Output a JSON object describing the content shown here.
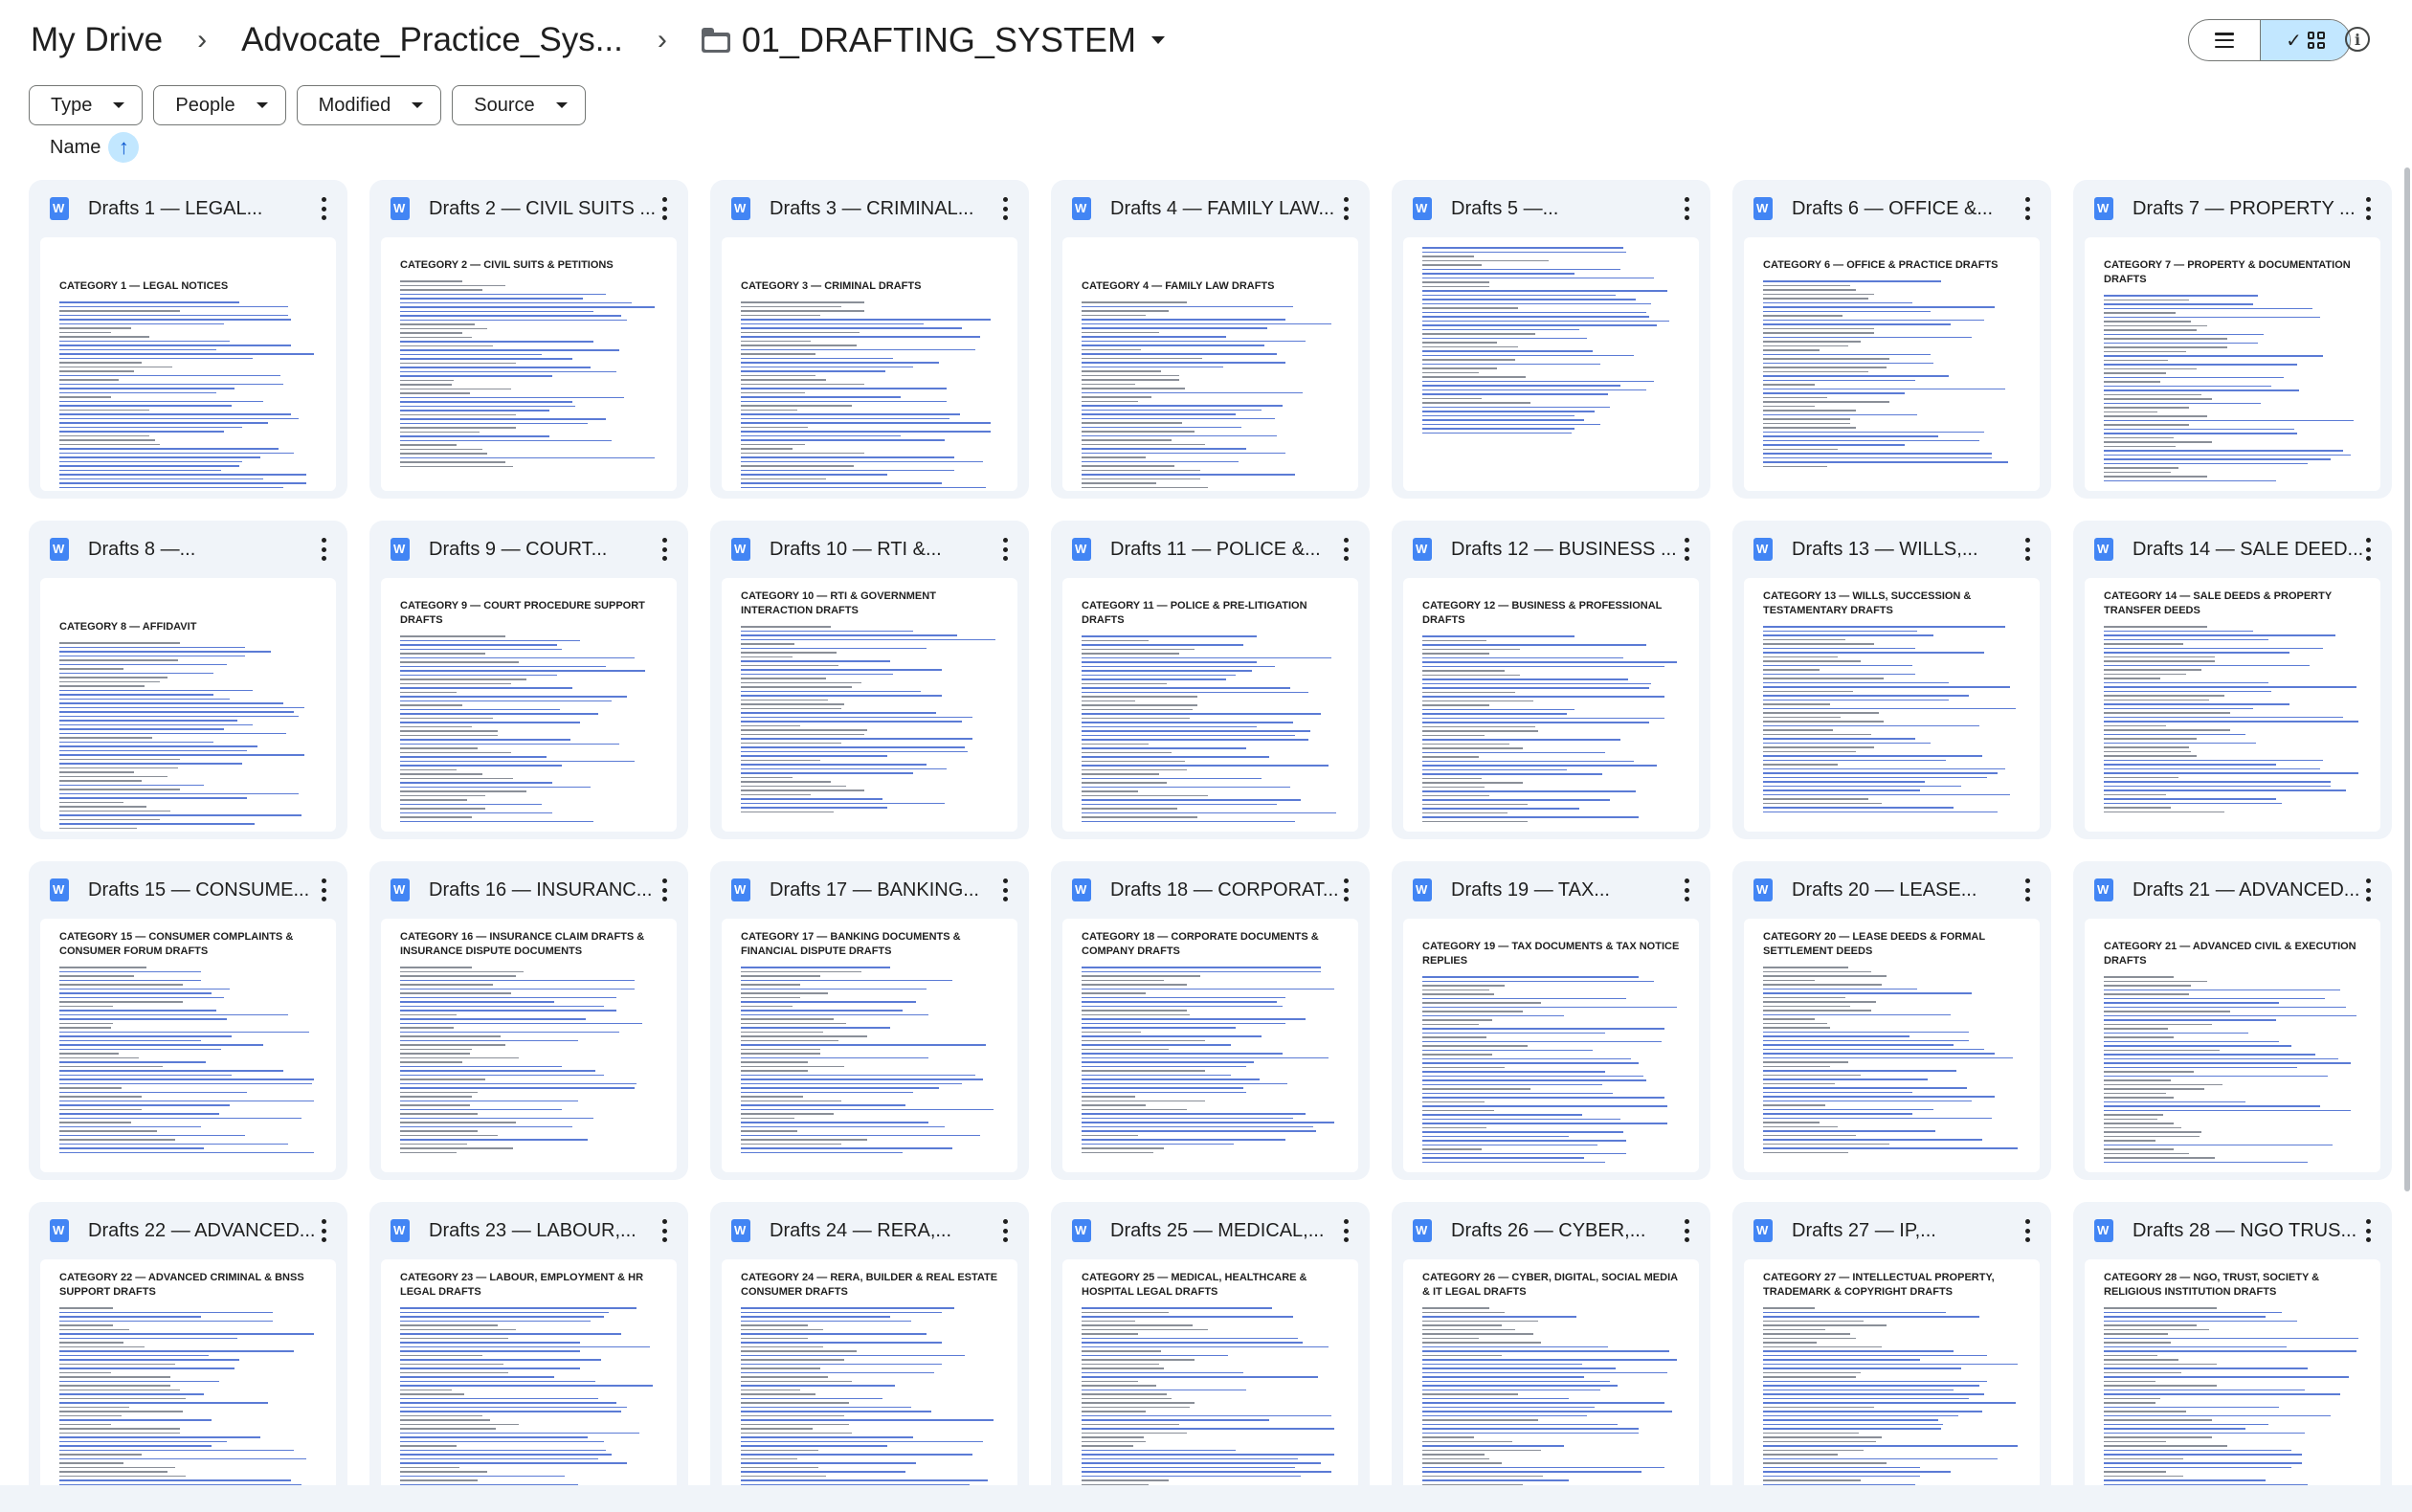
{
  "breadcrumb": {
    "root": "My Drive",
    "parent": "Advocate_Practice_Sys...",
    "current": "01_DRAFTING_SYSTEM",
    "separator": "›"
  },
  "view": {
    "list_icon": "list-view-icon",
    "grid_icon": "grid-view-icon",
    "active": "grid",
    "info_icon": "info-icon"
  },
  "filters": [
    {
      "label": "Type"
    },
    {
      "label": "People"
    },
    {
      "label": "Modified"
    },
    {
      "label": "Source"
    }
  ],
  "sort": {
    "label": "Name",
    "direction_icon": "arrow-up-icon",
    "arrow": "↑"
  },
  "colors": {
    "accent": "#c2e7ff",
    "card_bg": "#f0f4f9",
    "doc_icon": "#4285f4"
  },
  "files": [
    {
      "title": "Drafts 1 — LEGAL...",
      "heading": "CATEGORY 1 — LEGAL NOTICES"
    },
    {
      "title": "Drafts 2 — CIVIL SUITS ...",
      "heading": "CATEGORY 2 — CIVIL SUITS & PETITIONS"
    },
    {
      "title": "Drafts 3 — CRIMINAL...",
      "heading": "CATEGORY 3 — CRIMINAL DRAFTS"
    },
    {
      "title": "Drafts 4 — FAMILY LAW...",
      "heading": "CATEGORY 4 — FAMILY LAW DRAFTS"
    },
    {
      "title": "Drafts 5 —...",
      "heading": ""
    },
    {
      "title": "Drafts 6 — OFFICE &...",
      "heading": "CATEGORY 6 — OFFICE & PRACTICE DRAFTS"
    },
    {
      "title": "Drafts 7 — PROPERTY ...",
      "heading": "CATEGORY 7 — PROPERTY & DOCUMENTATION DRAFTS"
    },
    {
      "title": "Drafts 8 —...",
      "heading": "CATEGORY 8 — AFFIDAVIT"
    },
    {
      "title": "Drafts 9 — COURT...",
      "heading": "CATEGORY 9 — COURT PROCEDURE SUPPORT DRAFTS"
    },
    {
      "title": "Drafts 10 — RTI &...",
      "heading": "CATEGORY 10 — RTI & GOVERNMENT INTERACTION DRAFTS"
    },
    {
      "title": "Drafts 11 — POLICE &...",
      "heading": "CATEGORY 11 — POLICE & PRE-LITIGATION DRAFTS"
    },
    {
      "title": "Drafts 12 — BUSINESS ...",
      "heading": "CATEGORY 12 — BUSINESS & PROFESSIONAL DRAFTS"
    },
    {
      "title": "Drafts 13 — WILLS,...",
      "heading": "CATEGORY 13 — WILLS, SUCCESSION & TESTAMENTARY DRAFTS"
    },
    {
      "title": "Drafts 14 — SALE DEED...",
      "heading": "CATEGORY 14 — SALE DEEDS & PROPERTY TRANSFER DEEDS"
    },
    {
      "title": "Drafts 15 — CONSUME...",
      "heading": "CATEGORY 15 — CONSUMER COMPLAINTS & CONSUMER FORUM DRAFTS"
    },
    {
      "title": "Drafts 16 — INSURANC...",
      "heading": "CATEGORY 16 — INSURANCE CLAIM DRAFTS & INSURANCE DISPUTE DOCUMENTS"
    },
    {
      "title": "Drafts 17 — BANKING...",
      "heading": "CATEGORY 17 — BANKING DOCUMENTS & FINANCIAL DISPUTE DRAFTS"
    },
    {
      "title": "Drafts 18 — CORPORAT...",
      "heading": "CATEGORY 18 — CORPORATE DOCUMENTS & COMPANY DRAFTS"
    },
    {
      "title": "Drafts 19 — TAX...",
      "heading": "CATEGORY 19 — TAX DOCUMENTS & TAX NOTICE REPLIES"
    },
    {
      "title": "Drafts 20 — LEASE...",
      "heading": "CATEGORY 20 — LEASE DEEDS & FORMAL SETTLEMENT DEEDS"
    },
    {
      "title": "Drafts 21 — ADVANCED...",
      "heading": "CATEGORY 21 — ADVANCED CIVIL & EXECUTION DRAFTS"
    },
    {
      "title": "Drafts 22 — ADVANCED...",
      "heading": "CATEGORY 22 — ADVANCED CRIMINAL & BNSS SUPPORT DRAFTS"
    },
    {
      "title": "Drafts 23 — LABOUR,...",
      "heading": "CATEGORY 23 — LABOUR, EMPLOYMENT & HR LEGAL DRAFTS"
    },
    {
      "title": "Drafts 24 — RERA,...",
      "heading": "CATEGORY 24 — RERA, BUILDER & REAL ESTATE CONSUMER DRAFTS"
    },
    {
      "title": "Drafts 25 — MEDICAL,...",
      "heading": "CATEGORY 25 — MEDICAL, HEALTHCARE & HOSPITAL LEGAL DRAFTS"
    },
    {
      "title": "Drafts 26 — CYBER,...",
      "heading": "CATEGORY 26 — CYBER, DIGITAL, SOCIAL MEDIA & IT LEGAL DRAFTS"
    },
    {
      "title": "Drafts 27 — IP,...",
      "heading": "CATEGORY 27 — INTELLECTUAL PROPERTY, TRADEMARK & COPYRIGHT DRAFTS"
    },
    {
      "title": "Drafts 28 — NGO TRUS...",
      "heading": "CATEGORY 28 — NGO, TRUST, SOCIETY & RELIGIOUS INSTITUTION DRAFTS"
    }
  ]
}
